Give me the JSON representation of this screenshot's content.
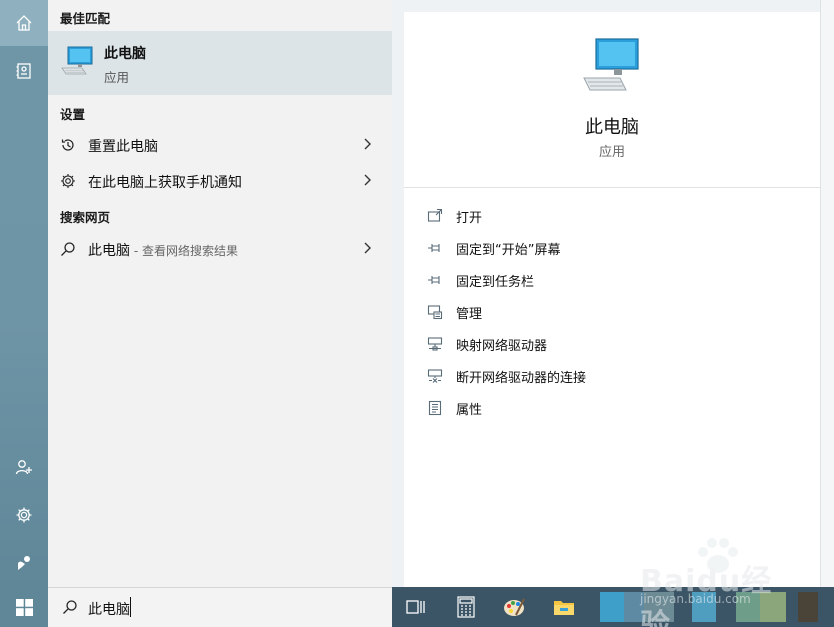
{
  "results": {
    "best_match_header": "最佳匹配",
    "best_match": {
      "name": "此电脑",
      "type": "应用"
    },
    "settings_header": "设置",
    "settings_items": [
      {
        "label": "重置此电脑"
      },
      {
        "label": "在此电脑上获取手机通知"
      }
    ],
    "web_header": "搜索网页",
    "web_item": {
      "label": "此电脑",
      "hint": " - 查看网络搜索结果"
    }
  },
  "search": {
    "query": "此电脑"
  },
  "detail": {
    "title": "此电脑",
    "subtitle": "应用",
    "actions": [
      {
        "label": "打开",
        "icon": "open-icon"
      },
      {
        "label": "固定到“开始”屏幕",
        "icon": "pin-icon"
      },
      {
        "label": "固定到任务栏",
        "icon": "pin-icon"
      },
      {
        "label": "管理",
        "icon": "manage-icon"
      },
      {
        "label": "映射网络驱动器",
        "icon": "network-drive-icon"
      },
      {
        "label": "断开网络驱动器的连接",
        "icon": "disconnect-drive-icon"
      },
      {
        "label": "属性",
        "icon": "properties-icon"
      }
    ]
  },
  "watermark": {
    "brand": "Baidu经验",
    "site": "jingyan.baidu.com"
  },
  "colors": {
    "rail": "#6e95a6",
    "highlight": "#dce4e7",
    "taskbar": "#3b5566",
    "accent": "#3aa0d8"
  }
}
